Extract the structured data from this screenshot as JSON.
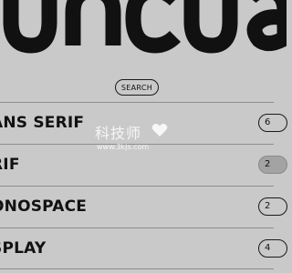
{
  "logo": {
    "text": "uncua",
    "icon": "brand-wordmark"
  },
  "search": {
    "label": "SEARCH",
    "icon": "search-pill"
  },
  "categories": [
    {
      "label": "ANS SERIF",
      "count": "6",
      "active": false
    },
    {
      "label": "RIF",
      "count": "2",
      "active": true
    },
    {
      "label": "ONOSPACE",
      "count": "2",
      "active": false
    },
    {
      "label": "SPLAY",
      "count": "4",
      "active": false
    }
  ],
  "watermark": {
    "text": "科技师",
    "url": "www.3kjs.com",
    "icon": "heart-icon"
  },
  "colors": {
    "background": "#c9c9c9",
    "text": "#111111",
    "divider": "#8d8d8d",
    "active_badge": "#a3a3a3",
    "watermark": "#ffffff"
  }
}
